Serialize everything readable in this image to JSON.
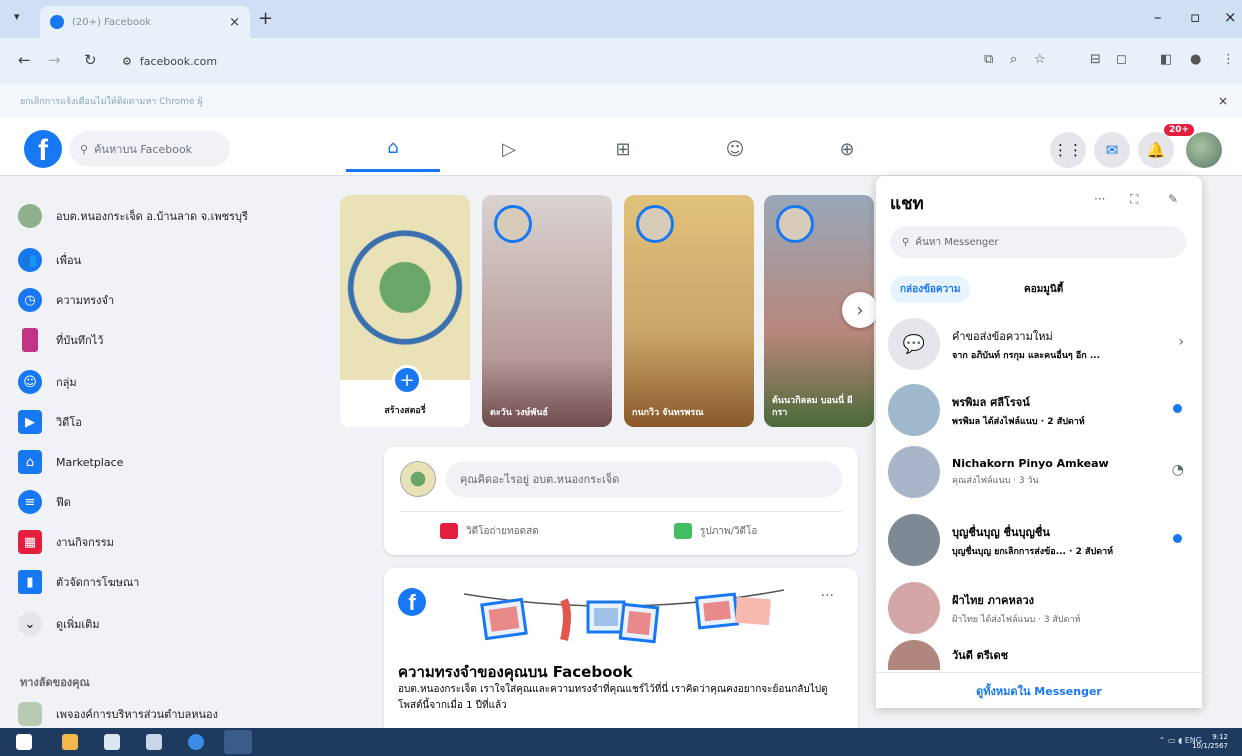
{
  "browser": {
    "tab_title": "(20+) Facebook",
    "tab_close": "×",
    "new_tab": "+",
    "url": "facebook.com",
    "infobar_text": "ยกเลิกการแจ้งเตือนไม่ให้ติดตามหา Chrome ผู้",
    "infobar_close": "×"
  },
  "topbar": {
    "logo": "f",
    "search_placeholder": "ค้นหาบน Facebook",
    "notification_count": "20+"
  },
  "sidebar": {
    "items": [
      {
        "label": "อบต.หนองกระเจ็ด อ.บ้านลาด จ.เพชรบุรี",
        "icon": "profile-icon",
        "color": "#8fb08a"
      },
      {
        "label": "เพื่อน",
        "icon": "friends-icon",
        "color": "#1877f2"
      },
      {
        "label": "ความทรงจำ",
        "icon": "clock-icon",
        "color": "#1877f2"
      },
      {
        "label": "ที่บันทึกไว้",
        "icon": "bookmark-icon",
        "color": "#c13584"
      },
      {
        "label": "กลุ่ม",
        "icon": "groups-icon",
        "color": "#1877f2"
      },
      {
        "label": "วิดีโอ",
        "icon": "video-icon",
        "color": "#1877f2"
      },
      {
        "label": "Marketplace",
        "icon": "marketplace-icon",
        "color": "#1877f2"
      },
      {
        "label": "ฟีด",
        "icon": "feed-icon",
        "color": "#1877f2"
      },
      {
        "label": "งานกิจกรรม",
        "icon": "calendar-icon",
        "color": "#e41e3f"
      },
      {
        "label": "ตัวจัดการโฆษณา",
        "icon": "chart-icon",
        "color": "#1877f2"
      },
      {
        "label": "ดูเพิ่มเติม",
        "icon": "chevron-down-icon",
        "color": "#e4e6eb"
      }
    ],
    "shortcuts_heading": "ทางลัดของคุณ",
    "shortcut_item": "เพจองค์การบริหารส่วนตำบลหนอง"
  },
  "stories": {
    "create_label": "สร้างสตอรี่",
    "items": [
      {
        "name": "ตะวัน วงษ์พันธ์",
        "bg": "#b89a9b"
      },
      {
        "name": "กนกวิว จันทรพรณ",
        "bg": "#c9a46a"
      },
      {
        "name": "ต้นนวกิลลม บอนนี่ ผีกรา",
        "bg": "#b9867a"
      }
    ]
  },
  "composer": {
    "placeholder": "คุณคิดอะไรอยู่ อบต.หนองกระเจ็ด",
    "live_label": "วิดีโอถ่ายทอดสด",
    "photo_label": "รูปภาพ/วิดีโอ"
  },
  "memory": {
    "logo": "f",
    "more": "···",
    "title": "ความทรงจำของคุณบน Facebook",
    "body": "อบต.หนองกระเจ็ด เราใจใส่คุณและความทรงจำที่คุณแชร์ไว้ที่นี่ เราคิดว่าคุณคงอยากจะย้อนกลับไปดูโพสต์นี้จากเมื่อ 1 ปีที่แล้ว"
  },
  "chat": {
    "title": "แชท",
    "search_placeholder": "ค้นหา Messenger",
    "tab_inbox": "กล่องข้อความ",
    "tab_community": "คอมมูนิตี้",
    "conversations": [
      {
        "name": "คำขอส่งข้อความใหม่",
        "msg": "จาก อภิบันท์ กรกุม และคนอื่นๆ อีก ...",
        "avatar_bg": "#e4e6eb",
        "avatar_glyph": "💬",
        "unread": false,
        "chevron": "›"
      },
      {
        "name": "พรพิมล ศลีโรจน์",
        "msg": "พรพิมล ได้ส่งไฟล์แนบ · 2 สัปดาห์",
        "avatar_bg": "#9fb8cc",
        "avatar_glyph": "",
        "unread": true,
        "chevron": ""
      },
      {
        "name": "Nichakorn Pinyo Amkeaw",
        "msg": "คุณส่งไฟล์แนบ · 3 วัน",
        "avatar_bg": "#a9b5c9",
        "avatar_glyph": "",
        "unread": false,
        "chevron": ""
      },
      {
        "name": "บุญชื่นบุญ ชื่นบุญชื่น",
        "msg": "บุญชื่นบุญ ยกเลิกการส่งข้อ... · 2 สัปดาห์",
        "avatar_bg": "#7d8a94",
        "avatar_glyph": "",
        "unread": true,
        "chevron": ""
      },
      {
        "name": "ฝ้าไทย ภาคหลวง",
        "msg": "ฝ้าไทย ได้ส่งไฟล์แนบ · 3 สัปดาห์",
        "avatar_bg": "#d4a7a7",
        "avatar_glyph": "",
        "unread": false,
        "chevron": ""
      },
      {
        "name": "วันดี ตรีเดช",
        "msg": "",
        "avatar_bg": "#b0867e",
        "avatar_glyph": "",
        "unread": false,
        "chevron": ""
      }
    ],
    "footer": "ดูทั้งหมดใน Messenger"
  },
  "taskbar": {
    "clock_time": "9:12",
    "clock_date": "10/1/2567",
    "lang": "ENG"
  }
}
